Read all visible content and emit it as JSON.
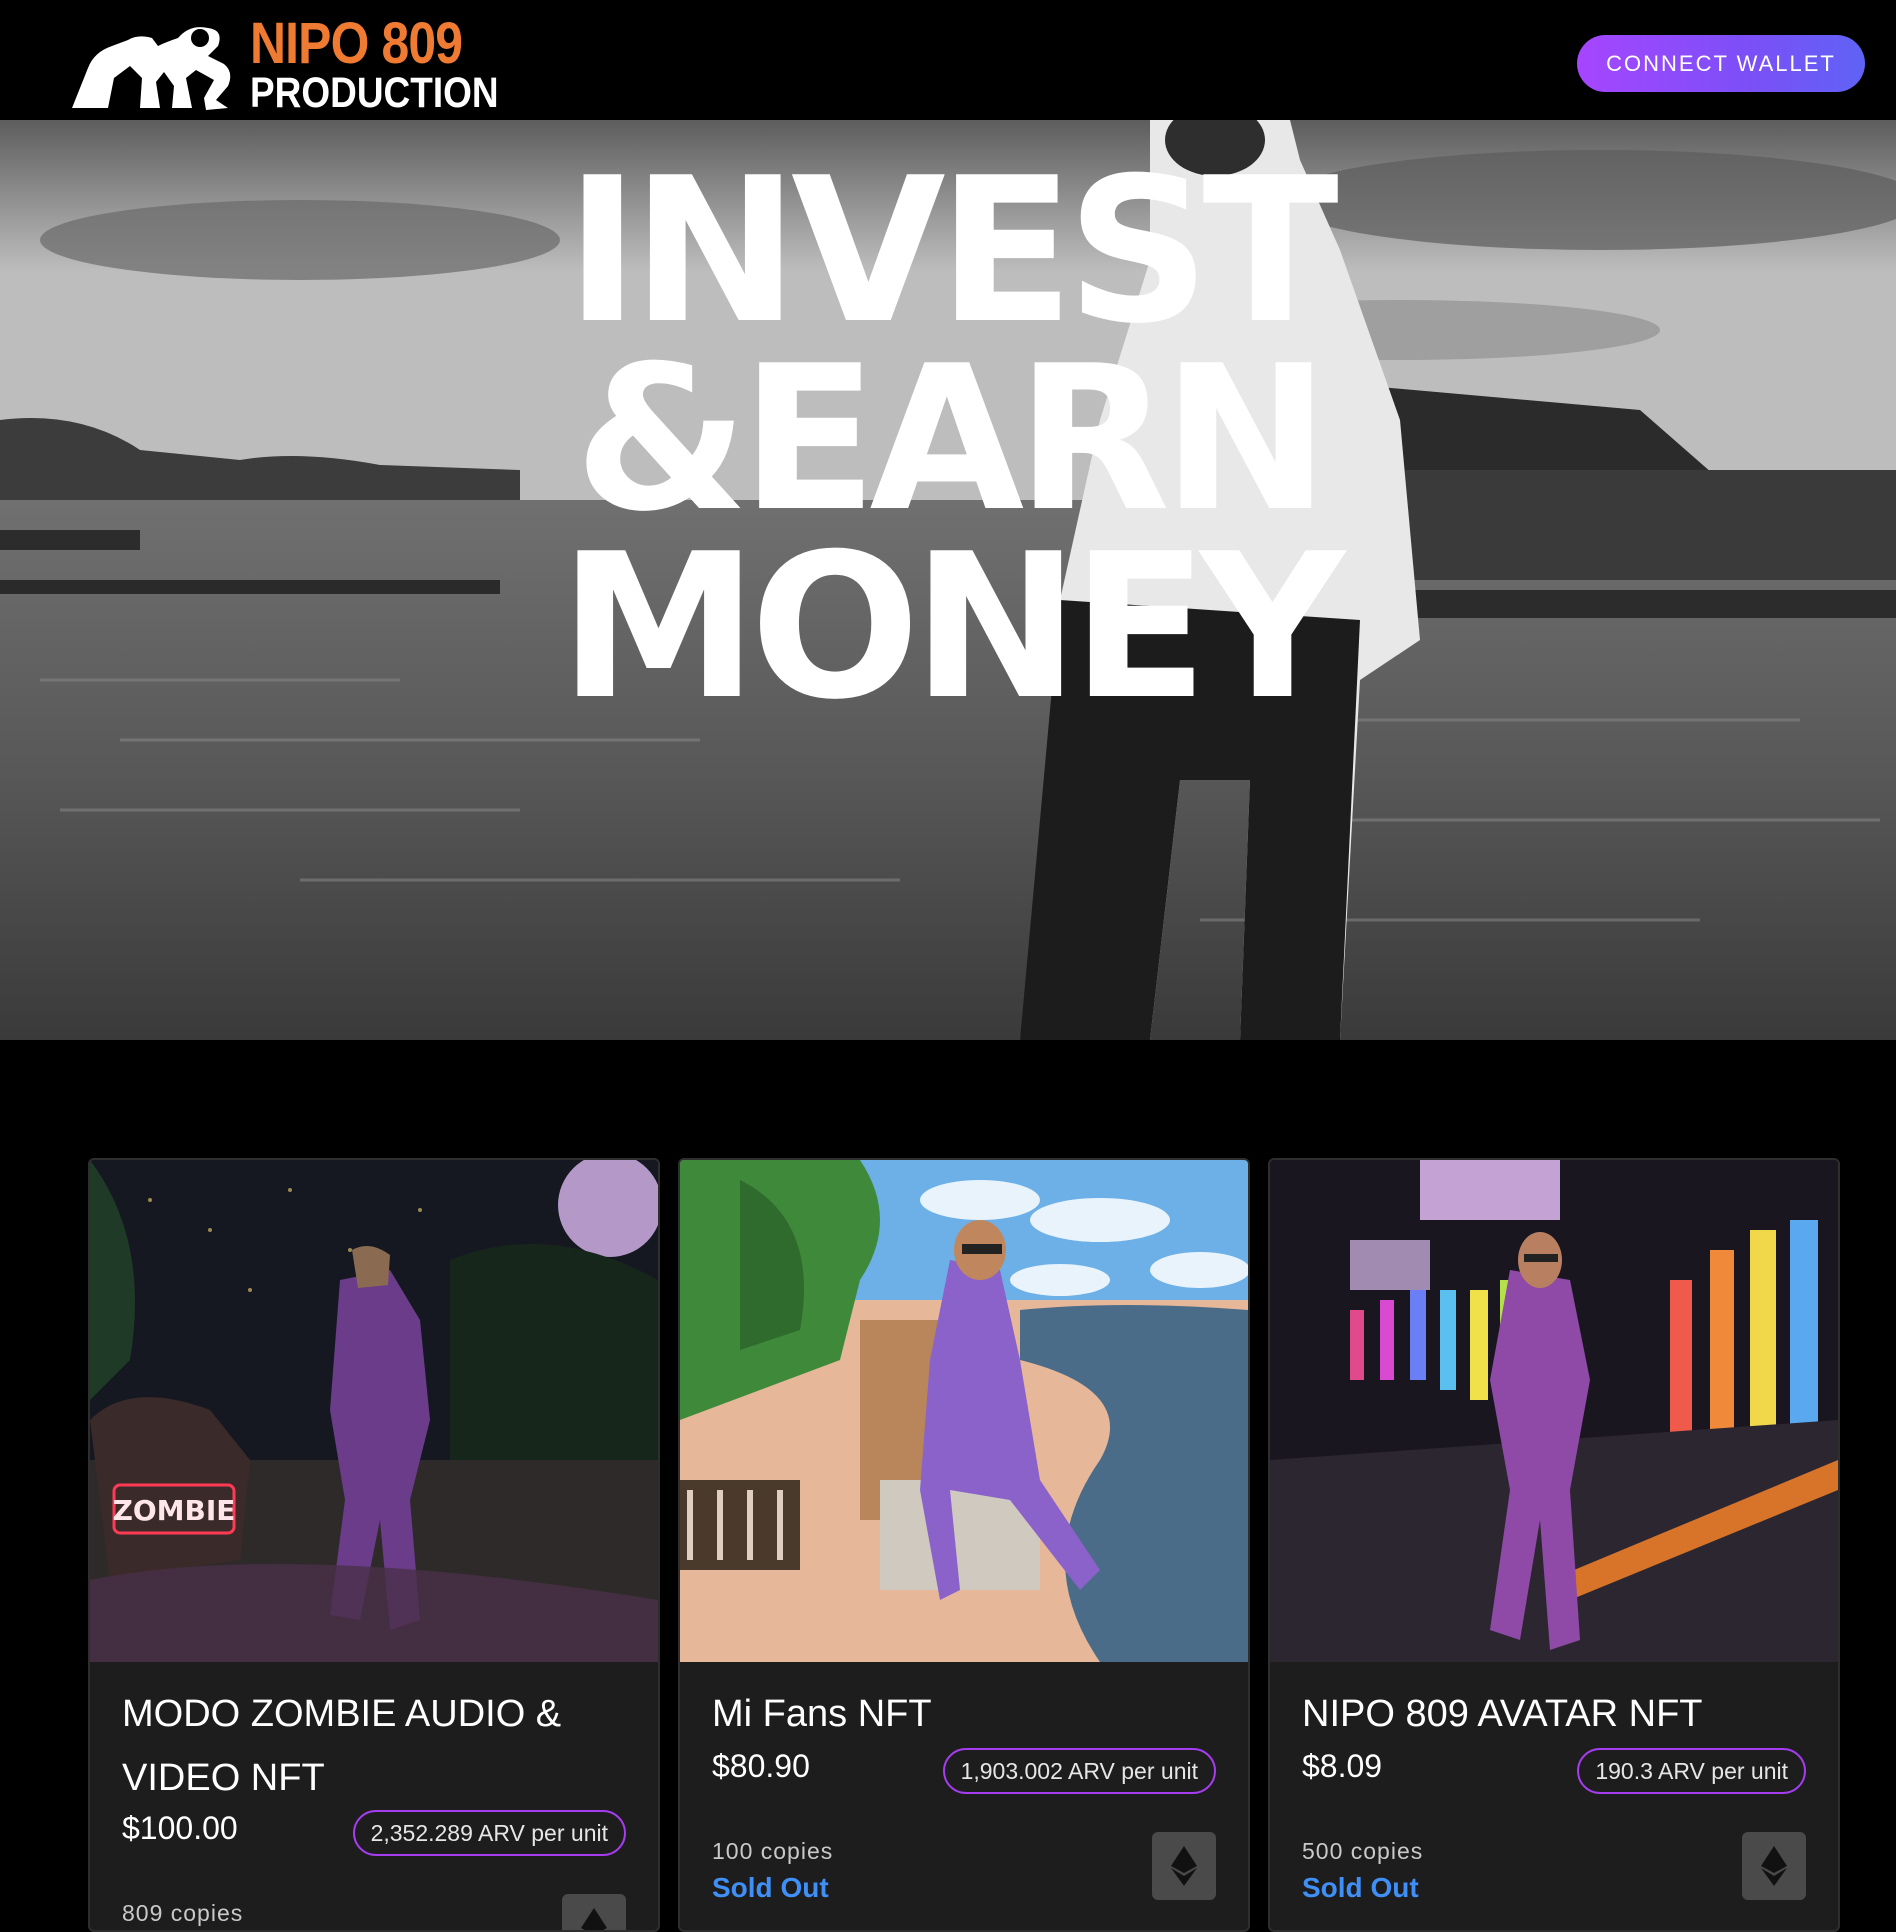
{
  "header": {
    "logo_line1": "NIPO 809",
    "logo_line2": "PRODUCTION",
    "connect_label": "CONNECT WALLET",
    "accent_color": "#ef7b32"
  },
  "hero": {
    "line1": "INVEST",
    "line2": "&EARN",
    "line3": "MONEY"
  },
  "cards": [
    {
      "title": "MODO ZOMBIE AUDIO & VIDEO NFT",
      "price": "$100.00",
      "arv": "2,352.289 ARV per unit",
      "copies": "809 copies",
      "sign_text": "ZOMBIE",
      "icon": "ethereum-icon"
    },
    {
      "title": "Mi Fans NFT",
      "price": "$80.90",
      "arv": "1,903.002 ARV per unit",
      "copies": "100 copies",
      "status": "Sold Out",
      "icon": "ethereum-icon"
    },
    {
      "title": "NIPO 809 AVATAR NFT",
      "price": "$8.09",
      "arv": "190.3 ARV per unit",
      "copies": "500 copies",
      "status": "Sold Out",
      "icon": "ethereum-icon"
    }
  ],
  "colors": {
    "button_gradient_start": "#a646ff",
    "button_gradient_end": "#5f63f5",
    "badge_border": "#a53cf0",
    "sold_out": "#3f8ff6"
  }
}
